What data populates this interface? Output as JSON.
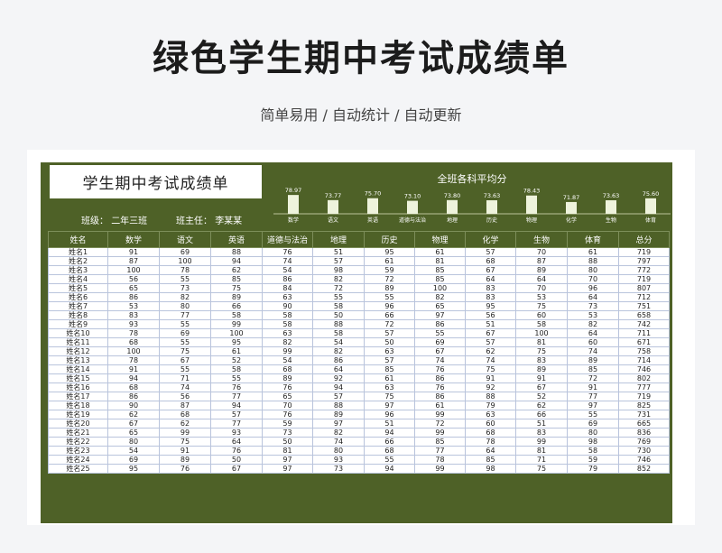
{
  "page": {
    "title": "绿色学生期中考试成绩单",
    "subtitle": "简单易用 / 自动统计 / 自动更新"
  },
  "sheet": {
    "title": "学生期中考试成绩单",
    "class_label": "班级：",
    "class_value": "二年三班",
    "teacher_label": "班主任：",
    "teacher_value": "李某某",
    "header_color": "#4e6127"
  },
  "chart_data": {
    "type": "bar",
    "title": "全班各科平均分",
    "categories": [
      "数学",
      "语文",
      "英语",
      "道德与法治",
      "地理",
      "历史",
      "物理",
      "化学",
      "生物",
      "体育"
    ],
    "values": [
      78.97,
      73.77,
      75.7,
      73.1,
      73.8,
      73.63,
      78.43,
      71.87,
      73.63,
      75.6
    ],
    "value_labels": [
      "78.97",
      "73.77",
      "75.70",
      "73.10",
      "73.80",
      "73.63",
      "78.43",
      "71.87",
      "73.63",
      "75.60"
    ],
    "bar_color": "#eef3dc"
  },
  "table": {
    "columns": [
      "姓名",
      "数学",
      "语文",
      "英语",
      "道德与法治",
      "地理",
      "历史",
      "物理",
      "化学",
      "生物",
      "体育",
      "总分"
    ],
    "rows": [
      [
        "姓名1",
        "91",
        "69",
        "88",
        "76",
        "51",
        "95",
        "61",
        "57",
        "70",
        "61",
        "719"
      ],
      [
        "姓名2",
        "87",
        "100",
        "94",
        "74",
        "57",
        "61",
        "81",
        "68",
        "87",
        "88",
        "797"
      ],
      [
        "姓名3",
        "100",
        "78",
        "62",
        "54",
        "98",
        "59",
        "85",
        "67",
        "89",
        "80",
        "772"
      ],
      [
        "姓名4",
        "56",
        "55",
        "85",
        "86",
        "82",
        "72",
        "85",
        "64",
        "64",
        "70",
        "719"
      ],
      [
        "姓名5",
        "65",
        "73",
        "75",
        "84",
        "72",
        "89",
        "100",
        "83",
        "70",
        "96",
        "807"
      ],
      [
        "姓名6",
        "86",
        "82",
        "89",
        "63",
        "55",
        "55",
        "82",
        "83",
        "53",
        "64",
        "712"
      ],
      [
        "姓名7",
        "53",
        "80",
        "66",
        "90",
        "58",
        "96",
        "65",
        "95",
        "75",
        "73",
        "751"
      ],
      [
        "姓名8",
        "83",
        "77",
        "58",
        "58",
        "50",
        "66",
        "97",
        "56",
        "60",
        "53",
        "658"
      ],
      [
        "姓名9",
        "93",
        "55",
        "99",
        "58",
        "88",
        "72",
        "86",
        "51",
        "58",
        "82",
        "742"
      ],
      [
        "姓名10",
        "78",
        "69",
        "100",
        "63",
        "58",
        "57",
        "55",
        "67",
        "100",
        "64",
        "711"
      ],
      [
        "姓名11",
        "68",
        "55",
        "95",
        "82",
        "54",
        "50",
        "69",
        "57",
        "81",
        "60",
        "671"
      ],
      [
        "姓名12",
        "100",
        "75",
        "61",
        "99",
        "82",
        "63",
        "67",
        "62",
        "75",
        "74",
        "758"
      ],
      [
        "姓名13",
        "78",
        "67",
        "52",
        "54",
        "86",
        "57",
        "74",
        "74",
        "83",
        "89",
        "714"
      ],
      [
        "姓名14",
        "91",
        "55",
        "58",
        "68",
        "64",
        "85",
        "76",
        "75",
        "89",
        "85",
        "746"
      ],
      [
        "姓名15",
        "94",
        "71",
        "55",
        "89",
        "92",
        "61",
        "86",
        "91",
        "91",
        "72",
        "802"
      ],
      [
        "姓名16",
        "68",
        "74",
        "76",
        "76",
        "94",
        "63",
        "76",
        "92",
        "67",
        "91",
        "777"
      ],
      [
        "姓名17",
        "86",
        "56",
        "77",
        "65",
        "57",
        "75",
        "86",
        "88",
        "52",
        "77",
        "719"
      ],
      [
        "姓名18",
        "90",
        "87",
        "94",
        "70",
        "88",
        "97",
        "61",
        "79",
        "62",
        "97",
        "825"
      ],
      [
        "姓名19",
        "62",
        "68",
        "57",
        "76",
        "89",
        "96",
        "99",
        "63",
        "66",
        "55",
        "731"
      ],
      [
        "姓名20",
        "67",
        "62",
        "77",
        "59",
        "97",
        "51",
        "72",
        "60",
        "51",
        "69",
        "665"
      ],
      [
        "姓名21",
        "65",
        "99",
        "93",
        "73",
        "82",
        "94",
        "99",
        "68",
        "83",
        "80",
        "836"
      ],
      [
        "姓名22",
        "80",
        "75",
        "64",
        "50",
        "74",
        "66",
        "85",
        "78",
        "99",
        "98",
        "769"
      ],
      [
        "姓名23",
        "54",
        "91",
        "76",
        "81",
        "80",
        "68",
        "77",
        "64",
        "81",
        "58",
        "730"
      ],
      [
        "姓名24",
        "69",
        "89",
        "50",
        "97",
        "93",
        "55",
        "78",
        "85",
        "71",
        "59",
        "746"
      ],
      [
        "姓名25",
        "95",
        "76",
        "67",
        "97",
        "73",
        "94",
        "99",
        "98",
        "75",
        "79",
        "852"
      ]
    ]
  }
}
